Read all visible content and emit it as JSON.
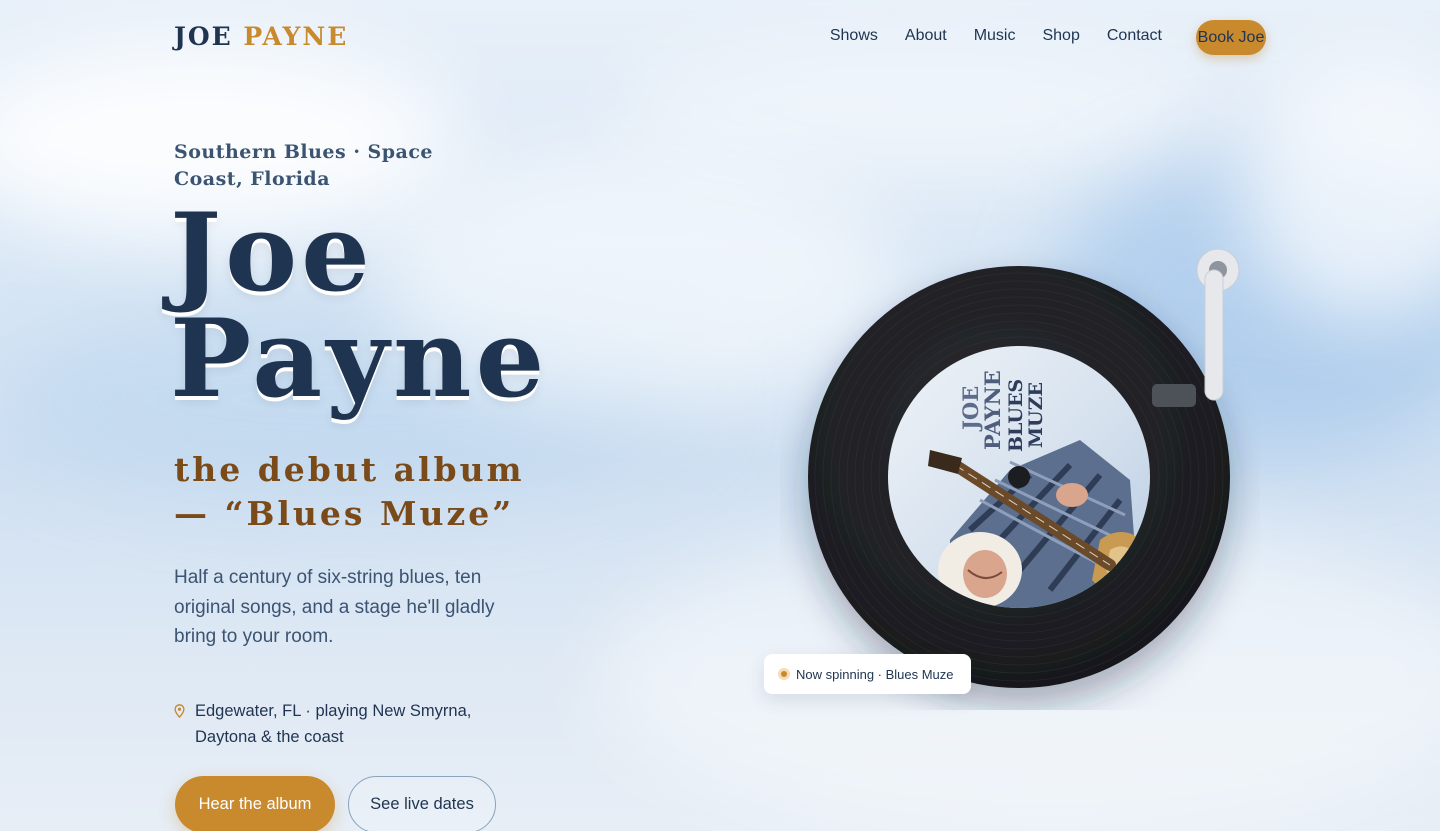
{
  "nav": {
    "logo_first": "JOE",
    "logo_last": "PAYNE",
    "links": [
      "Shows",
      "About",
      "Music",
      "Shop",
      "Contact"
    ],
    "cta": "Book Joe"
  },
  "hero": {
    "eyebrow": "Southern Blues · Space Coast, Florida",
    "title_line1": "Joe",
    "title_line2": "Payne",
    "album_line": "the debut album — “Blues Muze”",
    "blurb": "Half a century of six-string blues, ten original songs, and a stage he'll gladly bring to your room.",
    "location": "Edgewater, FL · playing New Smyrna, Daytona & the coast",
    "primary_button": "Hear the album",
    "secondary_button": "See live dates"
  },
  "record": {
    "label_lines": [
      "JOE",
      "PAYNE",
      "BLUES",
      "MUZE"
    ],
    "now_spinning": "Now spinning · Blues Muze"
  },
  "colors": {
    "navy": "#1f3450",
    "accent": "#c98a2e",
    "album_brown": "#7a4a19",
    "vinyl": "#1c1d21"
  },
  "icons": {
    "location": "map-pin-icon",
    "status": "orange-dot-icon"
  }
}
